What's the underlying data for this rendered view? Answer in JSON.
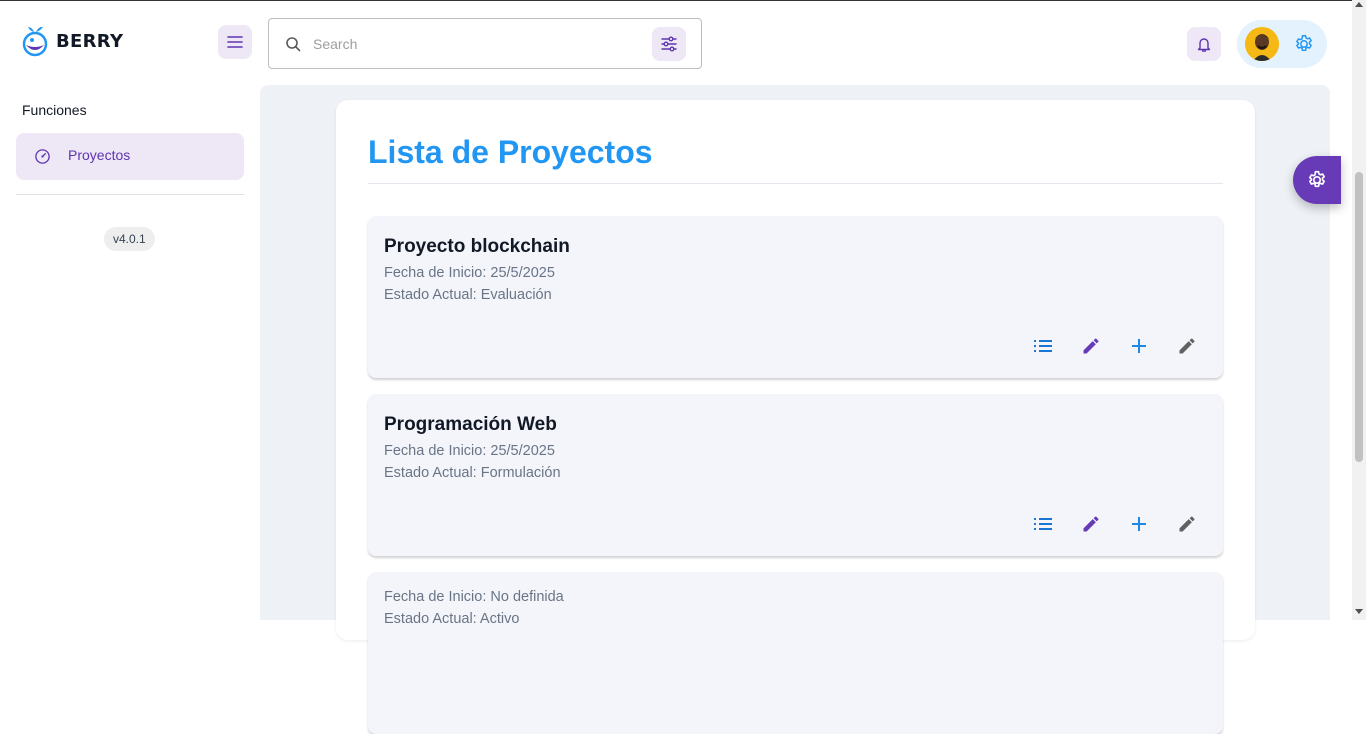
{
  "app": {
    "name": "BERRY"
  },
  "header": {
    "search_placeholder": "Search"
  },
  "sidebar": {
    "caption": "Funciones",
    "items": [
      {
        "label": "Proyectos",
        "icon": "dashboard-icon"
      }
    ],
    "version": "v4.0.1"
  },
  "main": {
    "title": "Lista de Proyectos",
    "projects": [
      {
        "name": "Proyecto blockchain",
        "start": "Fecha de Inicio: 25/5/2025",
        "status": "Estado Actual: Evaluación"
      },
      {
        "name": "Programación Web",
        "start": "Fecha de Inicio: 25/5/2025",
        "status": "Estado Actual: Formulación"
      },
      {
        "name": "",
        "start": "Fecha de Inicio: No definida",
        "status": "Estado Actual: Activo"
      }
    ]
  },
  "colors": {
    "primary_blue": "#2196f3",
    "secondary_purple": "#673ab7",
    "light_purple": "#ede7f6",
    "page_bg": "#eef2f6"
  }
}
